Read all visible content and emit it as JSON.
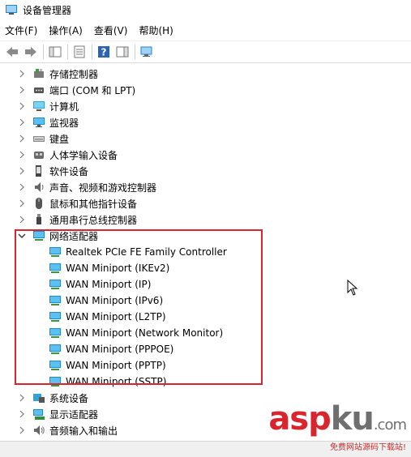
{
  "window": {
    "title": "设备管理器"
  },
  "menu": [
    {
      "label": "文件(F)"
    },
    {
      "label": "操作(A)"
    },
    {
      "label": "查看(V)"
    },
    {
      "label": "帮助(H)"
    }
  ],
  "tree": {
    "categories_top": [
      {
        "label": "存储控制器",
        "icon": "storage-controller-icon"
      },
      {
        "label": "端口 (COM 和 LPT)",
        "icon": "port-icon"
      },
      {
        "label": "计算机",
        "icon": "computer-icon"
      },
      {
        "label": "监视器",
        "icon": "monitor-icon"
      },
      {
        "label": "键盘",
        "icon": "keyboard-icon"
      },
      {
        "label": "人体学输入设备",
        "icon": "hid-icon"
      },
      {
        "label": "软件设备",
        "icon": "software-device-icon"
      },
      {
        "label": "声音、视频和游戏控制器",
        "icon": "sound-icon"
      },
      {
        "label": "鼠标和其他指针设备",
        "icon": "mouse-icon"
      },
      {
        "label": "通用串行总线控制器",
        "icon": "usb-icon"
      }
    ],
    "expanded": {
      "label": "网络适配器",
      "children": [
        "Realtek PCIe FE Family Controller",
        "WAN Miniport (IKEv2)",
        "WAN Miniport (IP)",
        "WAN Miniport (IPv6)",
        "WAN Miniport (L2TP)",
        "WAN Miniport (Network Monitor)",
        "WAN Miniport (PPPOE)",
        "WAN Miniport (PPTP)",
        "WAN Miniport (SSTP)"
      ]
    },
    "categories_bottom": [
      {
        "label": "系统设备",
        "icon": "system-device-icon"
      },
      {
        "label": "显示适配器",
        "icon": "display-adapter-icon"
      },
      {
        "label": "音频输入和输出",
        "icon": "audio-io-icon"
      }
    ]
  },
  "watermark": {
    "logo_a": "asp",
    "logo_b": "ku",
    "logo_c": ".com",
    "subtitle": "免费网站源码下载站!"
  },
  "colors": {
    "highlight": "#d9262e",
    "monitor": "#2ea3dc"
  }
}
